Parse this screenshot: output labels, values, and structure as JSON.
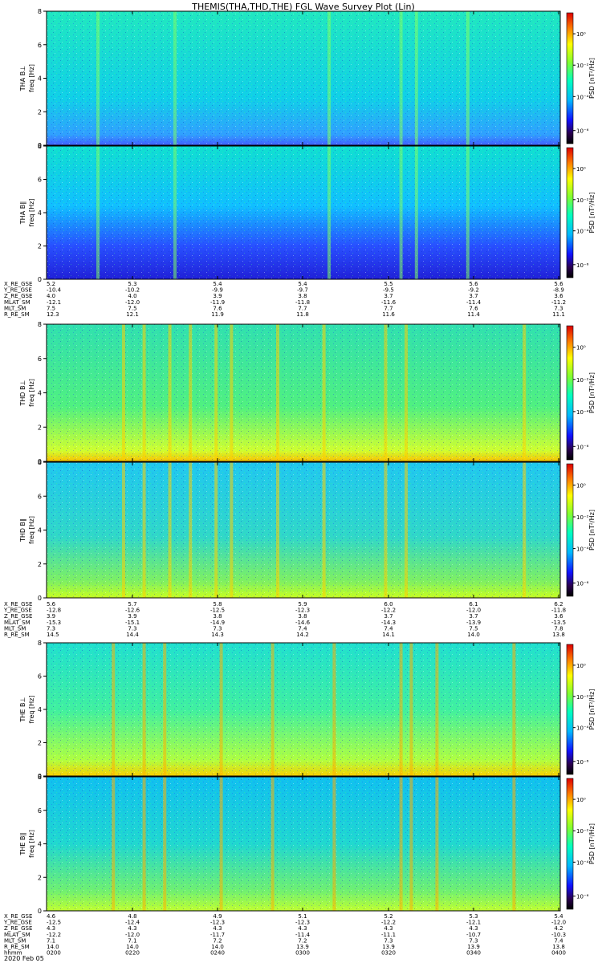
{
  "title": "THEMIS(THA,THD,THE) FGL Wave Survey Plot (Lin)",
  "colorbar": {
    "label": "PSD [nT²/Hz]",
    "ticks": [
      "10⁰",
      "10⁻²",
      "10⁻⁴",
      "10⁻⁶"
    ]
  },
  "ylabel_unit": "freq [Hz]",
  "date_label": "2020 Feb 05",
  "chart_data": {
    "type": "heatmap",
    "xlabel_rows": [
      "X_RE_GSE",
      "Y_RE_GSE",
      "Z_RE_GSE",
      "MLAT_SM",
      "MLT_SM",
      "R_RE_SM",
      "hhmm"
    ],
    "time_ticks": [
      "0200",
      "0220",
      "0240",
      "0300",
      "0320",
      "0340",
      "0400"
    ],
    "y_ticks": [
      "0",
      "2",
      "4",
      "6",
      "8"
    ],
    "ylim": [
      0,
      8
    ],
    "probes": [
      {
        "probe": "THA",
        "panels": [
          {
            "label": "THA B⊥"
          },
          {
            "label": "THA B∥"
          }
        ],
        "ephemeris": {
          "X_RE_GSE": [
            "5.2",
            "5.3",
            "5.4",
            "5.4",
            "5.5",
            "5.6",
            "5.6"
          ],
          "Y_RE_GSE": [
            "-10.4",
            "-10.2",
            "-9.9",
            "-9.7",
            "-9.5",
            "-9.2",
            "-8.9"
          ],
          "Z_RE_GSE": [
            "4.0",
            "4.0",
            "3.9",
            "3.8",
            "3.7",
            "3.7",
            "3.6"
          ],
          "MLAT_SM": [
            "-12.1",
            "-12.0",
            "-11.9",
            "-11.8",
            "-11.6",
            "-11.4",
            "-11.2"
          ],
          "MLT_SM": [
            "7.5",
            "7.5",
            "7.6",
            "7.7",
            "7.7",
            "7.6",
            "7.3"
          ],
          "R_RE_SM": [
            "12.3",
            "12.1",
            "11.9",
            "11.8",
            "11.6",
            "11.4",
            "11.1"
          ]
        }
      },
      {
        "probe": "THD",
        "panels": [
          {
            "label": "THD B⊥"
          },
          {
            "label": "THD B∥"
          }
        ],
        "ephemeris": {
          "X_RE_GSE": [
            "5.6",
            "5.7",
            "5.8",
            "5.9",
            "6.0",
            "6.1",
            "6.2"
          ],
          "Y_RE_GSE": [
            "-12.8",
            "-12.6",
            "-12.5",
            "-12.3",
            "-12.2",
            "-12.0",
            "-11.8"
          ],
          "Z_RE_GSE": [
            "3.9",
            "3.9",
            "3.8",
            "3.8",
            "3.7",
            "3.7",
            "3.6"
          ],
          "MLAT_SM": [
            "-15.3",
            "-15.1",
            "-14.9",
            "-14.6",
            "-14.3",
            "-13.9",
            "-13.5"
          ],
          "MLT_SM": [
            "7.3",
            "7.3",
            "7.3",
            "7.4",
            "7.4",
            "7.5",
            "7.8"
          ],
          "R_RE_SM": [
            "14.5",
            "14.4",
            "14.3",
            "14.2",
            "14.1",
            "14.0",
            "13.8"
          ]
        }
      },
      {
        "probe": "THE",
        "panels": [
          {
            "label": "THE B⊥"
          },
          {
            "label": "THE B∥"
          }
        ],
        "ephemeris": {
          "X_RE_GSE": [
            "4.6",
            "4.8",
            "4.9",
            "5.1",
            "5.2",
            "5.3",
            "5.4"
          ],
          "Y_RE_GSE": [
            "-12.5",
            "-12.4",
            "-12.3",
            "-12.3",
            "-12.2",
            "-12.1",
            "-12.0"
          ],
          "Z_RE_GSE": [
            "4.3",
            "4.3",
            "4.3",
            "4.3",
            "4.3",
            "4.3",
            "4.2"
          ],
          "MLAT_SM": [
            "-12.2",
            "-12.0",
            "-11.7",
            "-11.4",
            "-11.1",
            "-10.7",
            "-10.3"
          ],
          "MLT_SM": [
            "7.1",
            "7.1",
            "7.2",
            "7.2",
            "7.3",
            "7.3",
            "7.4"
          ],
          "R_RE_SM": [
            "14.0",
            "14.0",
            "14.0",
            "13.9",
            "13.9",
            "13.9",
            "13.8"
          ]
        }
      }
    ]
  }
}
